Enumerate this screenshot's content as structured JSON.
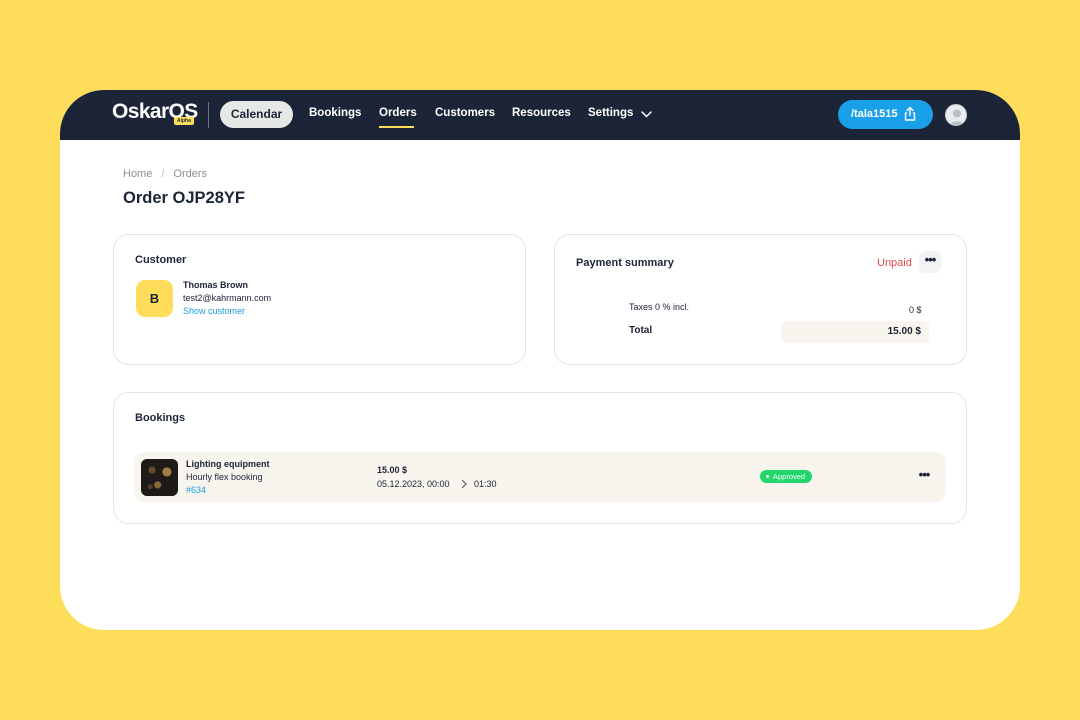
{
  "nav": {
    "logo": "OskarOS",
    "logo_badge": "Alpha",
    "calendar": "Calendar",
    "bookings": "Bookings",
    "orders": "Orders",
    "customers": "Customers",
    "resources": "Resources",
    "settings": "Settings",
    "user_pill": "/tala1515",
    "active_tab": "Orders"
  },
  "breadcrumb": {
    "home": "Home",
    "separator": "/",
    "current": "Orders"
  },
  "page": {
    "title": "Order OJP28YF"
  },
  "customer_card": {
    "title": "Customer",
    "avatar_initial": "B",
    "name": "Thomas Brown",
    "email": "test2@kahrmann.com",
    "link": "Show customer"
  },
  "payment_card": {
    "title": "Payment summary",
    "status": "Unpaid",
    "taxes_label": "Taxes 0 % incl.",
    "taxes_value": "0 $",
    "total_label": "Total",
    "total_value": "15.00 $"
  },
  "bookings_card": {
    "title": "Bookings",
    "items": [
      {
        "name": "Lighting equipment",
        "type": "Hourly flex booking",
        "id": "#634",
        "price": "15.00 $",
        "start": "05.12.2023, 00:00",
        "end": "01:30",
        "status": "Approved"
      }
    ]
  },
  "colors": {
    "background": "#FEDD5A",
    "nav": "#1c2538",
    "accent_blue": "#1aa0e8",
    "unpaid_red": "#e04a4a",
    "approved_green": "#22d66c"
  },
  "icons": [
    "chevron-down-icon",
    "share-icon",
    "user-avatar-icon",
    "more-icon",
    "arrow-right-icon"
  ]
}
